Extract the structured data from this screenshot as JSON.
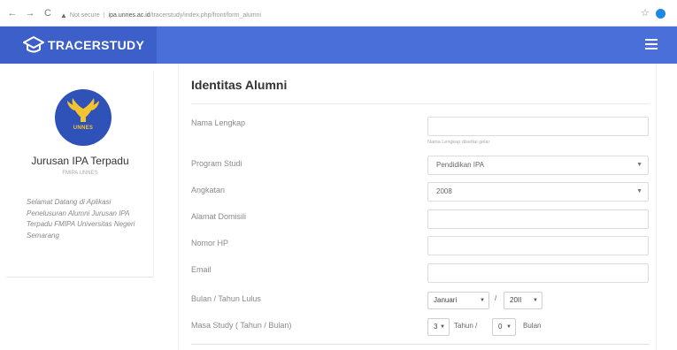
{
  "browser": {
    "back": "←",
    "forward": "→",
    "reload": "C",
    "security_label": "Not secure",
    "domain": "ipa.unnes.ac.id",
    "path": "/tracerstudy/index.php/front/form_alumni"
  },
  "header": {
    "brand_prefix": "TRACER",
    "brand_suffix": "STUDY"
  },
  "sidebar": {
    "logo_text": "UNNES",
    "department": "Jurusan IPA Terpadu",
    "faculty": "FMIPA UNNES",
    "welcome": "Selamat Datang di Aplikasi Penelusuran Alumni Jurusan IPA Terpadu FMIPA Universitas Negeri Semarang"
  },
  "form": {
    "title": "Identitas Alumni",
    "fields": {
      "nama": {
        "label": "Nama Lengkap",
        "value": "",
        "help": "Nama Lengkap disertai gelar"
      },
      "prodi": {
        "label": "Program Studi",
        "value": "Pendidikan IPA"
      },
      "angkatan": {
        "label": "Angkatan",
        "value": "2008"
      },
      "alamat": {
        "label": "Alamat Domisili",
        "value": ""
      },
      "hp": {
        "label": "Nomor HP",
        "value": ""
      },
      "email": {
        "label": "Email",
        "value": ""
      },
      "lulus": {
        "label": "Bulan / Tahun Lulus",
        "month": "Januari",
        "separator": "/",
        "year": "20II"
      },
      "masa": {
        "label": "Masa Study ( Tahun / Bulan)",
        "years": "3",
        "years_unit": "Tahun /",
        "months": "0",
        "months_unit": "Bulan"
      }
    }
  },
  "colors": {
    "header": "#4a6fd8",
    "brand": "#3d5fc9",
    "logo": "#2f52b8"
  }
}
